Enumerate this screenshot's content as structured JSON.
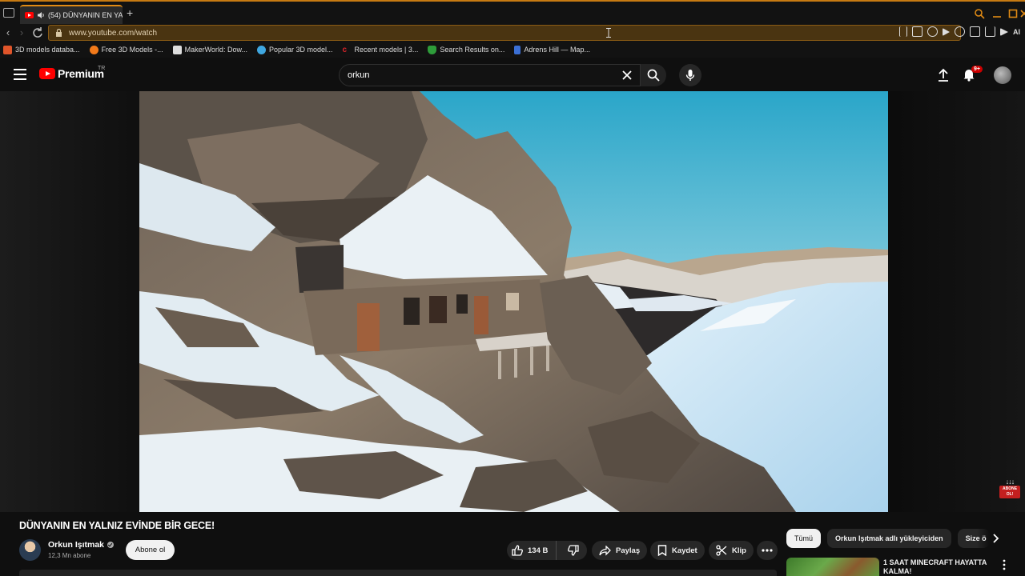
{
  "browser": {
    "tab_title": "(54) DÜNYANIN EN YA",
    "new_tab_symbol": "+",
    "url": "www.youtube.com/watch",
    "ai_label": "AI",
    "accent_color": "#e08a14",
    "bookmarks": [
      {
        "label": "3D models databa...",
        "color": "#e0552a"
      },
      {
        "label": "Free 3D Models -...",
        "color": "#f27a1a"
      },
      {
        "label": "MakerWorld: Dow...",
        "color": "#dddddd"
      },
      {
        "label": "Popular 3D model...",
        "color": "#3fa7e0"
      },
      {
        "label": "Recent models | 3...",
        "color": "#d8232a"
      },
      {
        "label": "Search Results on...",
        "color": "#2e9c3a"
      },
      {
        "label": "Adrens Hill — Map...",
        "color": "#3b6fd4"
      }
    ]
  },
  "youtube": {
    "logo_text": "Premium",
    "country_code": "TR",
    "search_query": "orkun",
    "notification_count": "9+",
    "brand_color": "#ff0000"
  },
  "video": {
    "title": "DÜNYANIN EN YALNIZ EVİNDE BİR GECE!",
    "overlay_label": "ABONE OL!",
    "overlay_arrows": "↓↓↓"
  },
  "channel": {
    "name": "Orkun Işıtmak",
    "subscribers": "12,3 Mn abone",
    "subscribe_label": "Abone ol"
  },
  "actions": {
    "likes": "134 B",
    "share": "Paylaş",
    "save": "Kaydet",
    "clip": "Klip"
  },
  "sidebar": {
    "chips": [
      "Tümü",
      "Orkun Işıtmak adlı yükleyiciden",
      "Size ö"
    ],
    "recommendation_title": "1 SAAT MINECRAFT HAYATTA KALMA!"
  }
}
